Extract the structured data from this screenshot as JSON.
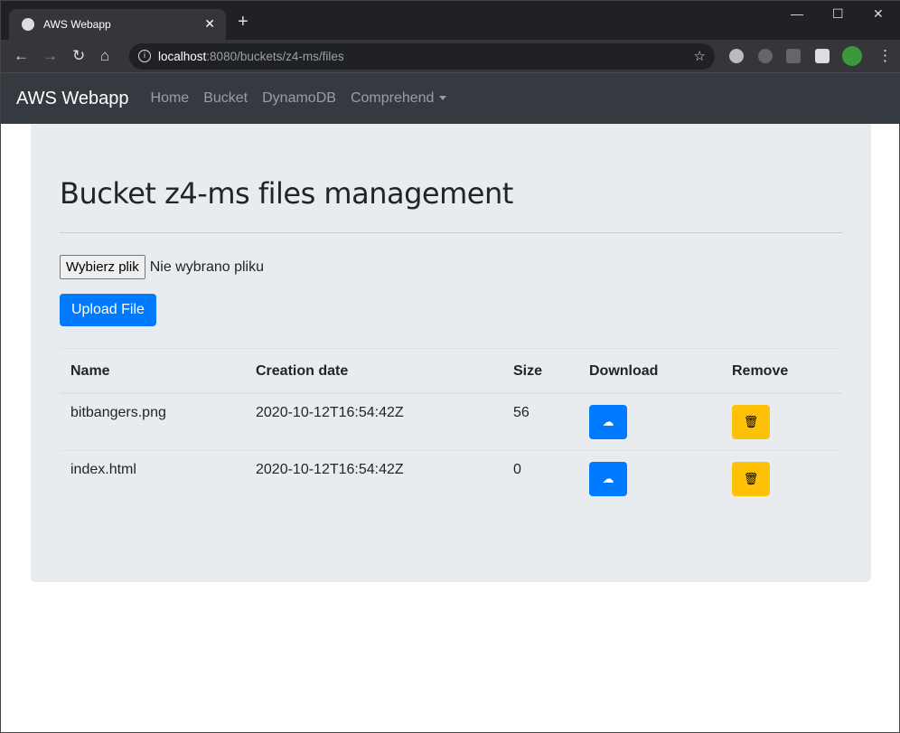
{
  "browser": {
    "tab_title": "AWS Webapp",
    "url_host": "localhost",
    "url_path": ":8080/buckets/z4-ms/files"
  },
  "navbar": {
    "brand": "AWS Webapp",
    "links": [
      "Home",
      "Bucket",
      "DynamoDB",
      "Comprehend"
    ]
  },
  "page": {
    "title": "Bucket z4-ms files management",
    "choose_file": "Wybierz plik",
    "no_file": "Nie wybrano pliku",
    "upload": "Upload File"
  },
  "table": {
    "headers": [
      "Name",
      "Creation date",
      "Size",
      "Download",
      "Remove"
    ],
    "rows": [
      {
        "name": "bitbangers.png",
        "date": "2020-10-12T16:54:42Z",
        "size": "56"
      },
      {
        "name": "index.html",
        "date": "2020-10-12T16:54:42Z",
        "size": "0"
      }
    ]
  }
}
